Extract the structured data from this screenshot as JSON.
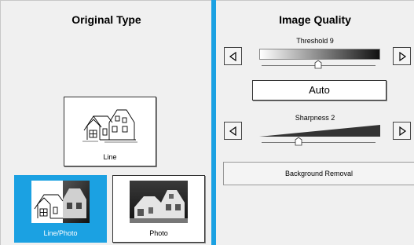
{
  "original_type": {
    "title": "Original Type",
    "options": [
      {
        "label": "Line",
        "selected": false
      },
      {
        "label": "Line/Photo",
        "selected": true
      },
      {
        "label": "Photo",
        "selected": false
      }
    ]
  },
  "image_quality": {
    "title": "Image Quality",
    "threshold": {
      "label": "Threshold 9",
      "value": 9
    },
    "auto_label": "Auto",
    "sharpness": {
      "label": "Sharpness 2",
      "value": 2
    },
    "background_removal_label": "Background Removal"
  },
  "colors": {
    "accent": "#1ba1e2",
    "panel": "#f0f0f0"
  }
}
